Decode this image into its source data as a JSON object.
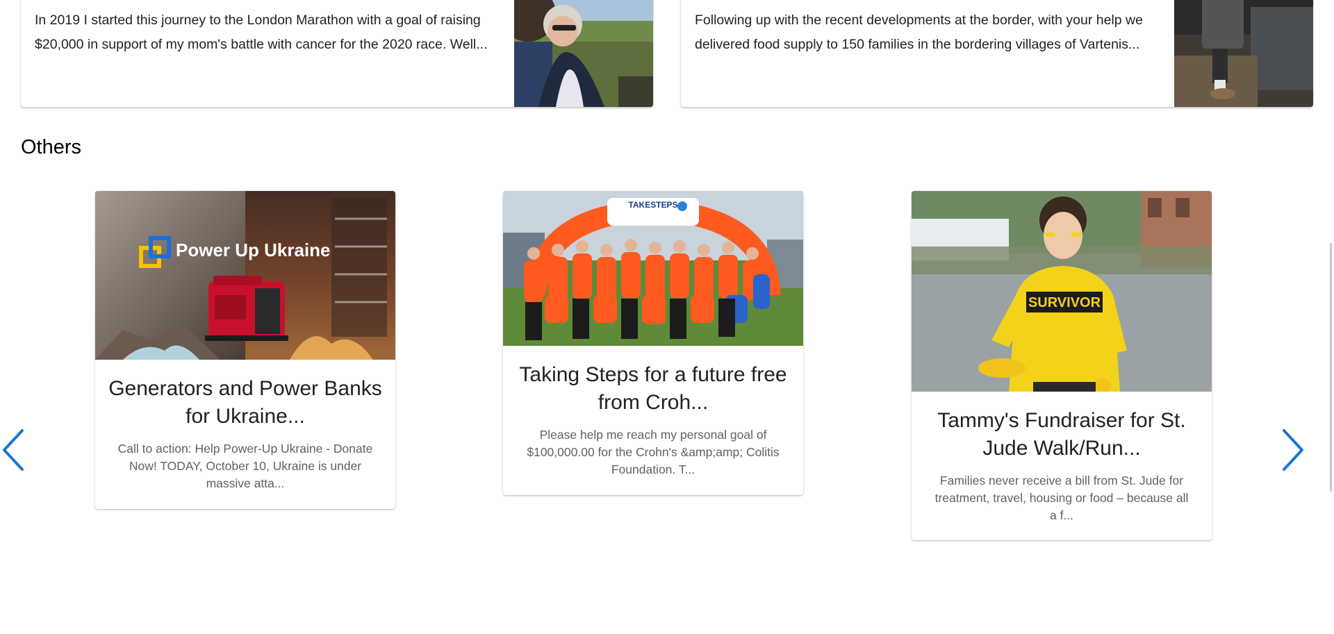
{
  "featured": [
    {
      "text": "In 2019 I started this journey to the London Marathon with a goal of raising $20,000 in support of my mom's battle with cancer for the 2020 race. Well..."
    },
    {
      "text": "Following up with the recent developments at the border, with your help we delivered food supply to 150 families in the bordering villages of Vartenis..."
    }
  ],
  "others": {
    "heading": "Others",
    "cards": [
      {
        "image_overlay": "Power Up Ukraine",
        "title": "Generators and Power Banks for Ukraine...",
        "description": "Call to action: Help Power-Up Ukraine - Donate Now! TODAY, October 10, Ukraine is under massive atta..."
      },
      {
        "image_overlay": "TAKESTEPS",
        "title": "Taking Steps for a future free from Croh...",
        "description": "Please help me reach my personal goal of $100,000.00 for the Crohn's &amp;amp; Colitis Foundation. T..."
      },
      {
        "image_overlay": "SURVIVOR",
        "title": "Tammy's Fundraiser for St. Jude Walk/Run...",
        "description": "Families never receive a bill from St. Jude for treatment, travel, housing or food – because all a f..."
      }
    ]
  },
  "icons": {
    "prev": "chevron-left-icon",
    "next": "chevron-right-icon"
  },
  "colors": {
    "accent": "#1976d2",
    "ukraine_blue": "#1e6fd9",
    "ukraine_yellow": "#f5c400",
    "generator_red": "#c8102e",
    "shirt_orange": "#ff5a1f",
    "shirt_yellow": "#f3d21b"
  }
}
